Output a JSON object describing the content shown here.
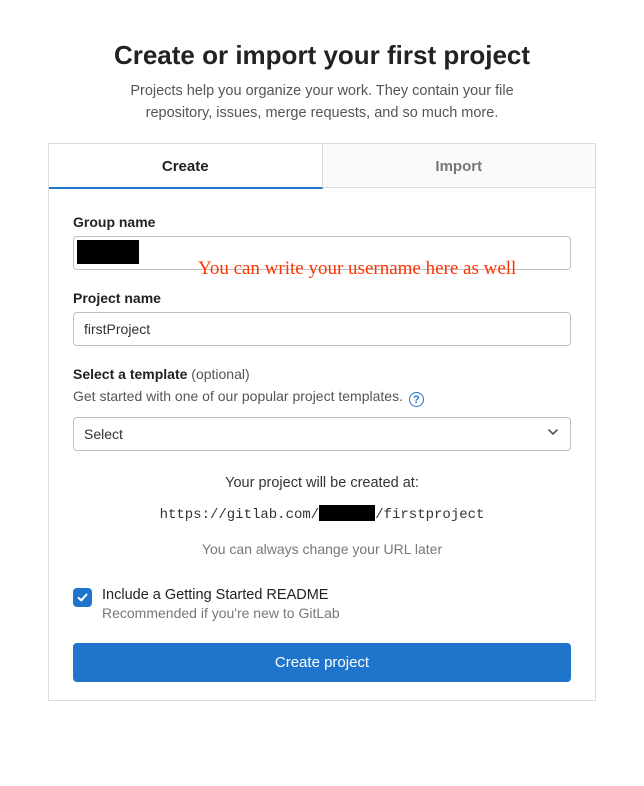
{
  "heading": "Create or import your first project",
  "subtitle": "Projects help you organize your work. They contain your file repository, issues, merge requests, and so much more.",
  "tabs": {
    "create": "Create",
    "import": "Import"
  },
  "form": {
    "group_label": "Group name",
    "group_value": "",
    "project_label": "Project name",
    "project_value": "firstProject",
    "template_label": "Select a template",
    "template_optional": "(optional)",
    "template_desc": "Get started with one of our popular project templates.",
    "select_placeholder": "Select",
    "created_at_label": "Your project will be created at:",
    "url_prefix": "https://gitlab.com/",
    "url_suffix": "/firstproject",
    "url_note": "You can always change your URL later",
    "readme_label": "Include a Getting Started README",
    "readme_sub": "Recommended if you're new to GitLab",
    "readme_checked": true,
    "submit": "Create project"
  },
  "annotation": "You can write your username here as well"
}
